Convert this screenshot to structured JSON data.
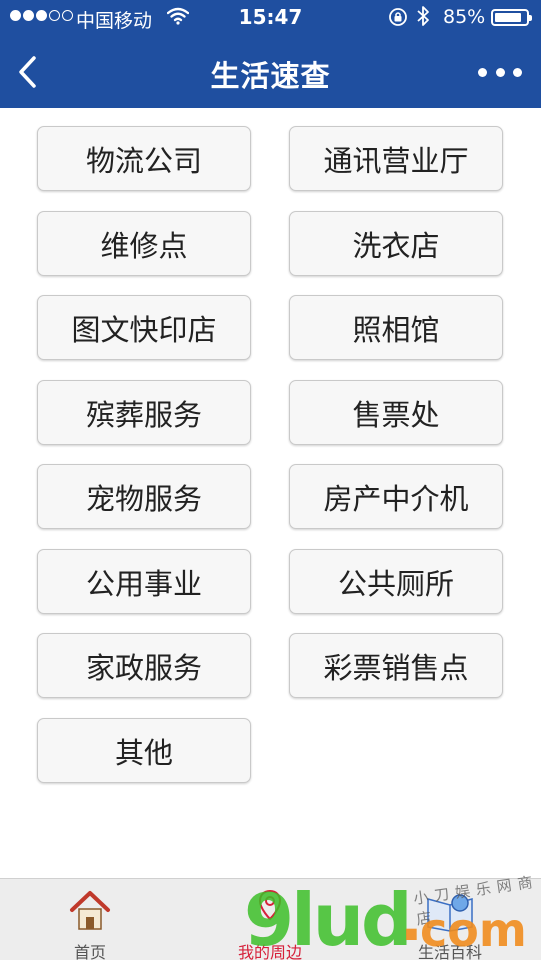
{
  "status_bar": {
    "carrier": "中国移动",
    "time": "15:47",
    "battery_text": "85%",
    "battery_level": 0.85,
    "signal_dots_filled": 3,
    "signal_dots_total": 5
  },
  "nav": {
    "title": "生活速查",
    "back_icon": "chevron-left-icon",
    "more_icon": "more-horizontal-icon"
  },
  "categories": [
    "物流公司",
    "通讯营业厅",
    "维修点",
    "洗衣店",
    "图文快印店",
    "照相馆",
    "殡葬服务",
    "售票处",
    "宠物服务",
    "房产中介机",
    "公用事业",
    "公共厕所",
    "家政服务",
    "彩票销售点",
    "其他"
  ],
  "tabs": [
    {
      "label": "首页",
      "icon": "home-icon",
      "active": false
    },
    {
      "label": "我的周边",
      "icon": "map-pin-icon",
      "active": true
    },
    {
      "label": "生活百科",
      "icon": "book-icon",
      "active": false
    }
  ],
  "colors": {
    "header_bg": "#1f4fa0",
    "active_tab": "#d6213a"
  },
  "watermark": {
    "main": "9lud",
    "suffix": "com",
    "small": "小刀娱乐网商店"
  }
}
